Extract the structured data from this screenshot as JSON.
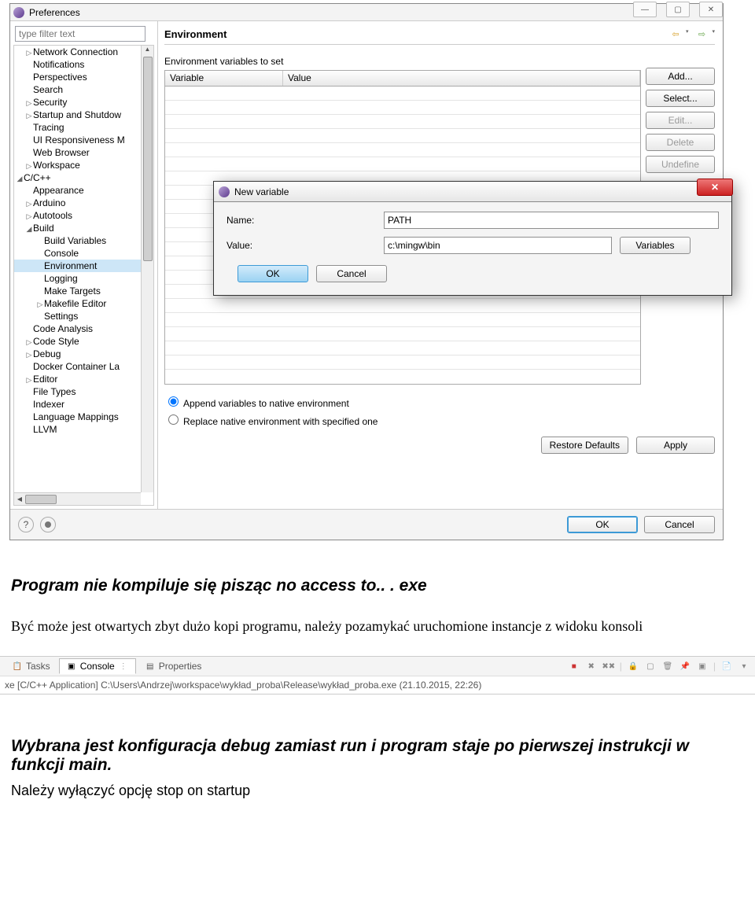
{
  "window": {
    "title": "Preferences",
    "filter_placeholder": "type filter text"
  },
  "tree": {
    "items": [
      {
        "label": "Network Connection",
        "indent": 1,
        "expander": "▷"
      },
      {
        "label": "Notifications",
        "indent": 1,
        "expander": ""
      },
      {
        "label": "Perspectives",
        "indent": 1,
        "expander": ""
      },
      {
        "label": "Search",
        "indent": 1,
        "expander": ""
      },
      {
        "label": "Security",
        "indent": 1,
        "expander": "▷"
      },
      {
        "label": "Startup and Shutdow",
        "indent": 1,
        "expander": "▷"
      },
      {
        "label": "Tracing",
        "indent": 1,
        "expander": ""
      },
      {
        "label": "UI Responsiveness M",
        "indent": 1,
        "expander": ""
      },
      {
        "label": "Web Browser",
        "indent": 1,
        "expander": ""
      },
      {
        "label": "Workspace",
        "indent": 1,
        "expander": "▷"
      },
      {
        "label": "C/C++",
        "indent": 0,
        "expander": "◢"
      },
      {
        "label": "Appearance",
        "indent": 1,
        "expander": ""
      },
      {
        "label": "Arduino",
        "indent": 1,
        "expander": "▷"
      },
      {
        "label": "Autotools",
        "indent": 1,
        "expander": "▷"
      },
      {
        "label": "Build",
        "indent": 1,
        "expander": "◢"
      },
      {
        "label": "Build Variables",
        "indent": 2,
        "expander": ""
      },
      {
        "label": "Console",
        "indent": 2,
        "expander": ""
      },
      {
        "label": "Environment",
        "indent": 2,
        "expander": "",
        "selected": true
      },
      {
        "label": "Logging",
        "indent": 2,
        "expander": ""
      },
      {
        "label": "Make Targets",
        "indent": 2,
        "expander": ""
      },
      {
        "label": "Makefile Editor",
        "indent": 2,
        "expander": "▷"
      },
      {
        "label": "Settings",
        "indent": 2,
        "expander": ""
      },
      {
        "label": "Code Analysis",
        "indent": 1,
        "expander": ""
      },
      {
        "label": "Code Style",
        "indent": 1,
        "expander": "▷"
      },
      {
        "label": "Debug",
        "indent": 1,
        "expander": "▷"
      },
      {
        "label": "Docker Container La",
        "indent": 1,
        "expander": ""
      },
      {
        "label": "Editor",
        "indent": 1,
        "expander": "▷"
      },
      {
        "label": "File Types",
        "indent": 1,
        "expander": ""
      },
      {
        "label": "Indexer",
        "indent": 1,
        "expander": ""
      },
      {
        "label": "Language Mappings",
        "indent": 1,
        "expander": ""
      },
      {
        "label": "LLVM",
        "indent": 1,
        "expander": ""
      }
    ]
  },
  "main": {
    "heading": "Environment",
    "env_label": "Environment variables to set",
    "col_variable": "Variable",
    "col_value": "Value",
    "btn_add": "Add...",
    "btn_select": "Select...",
    "btn_edit": "Edit...",
    "btn_delete": "Delete",
    "btn_undefine": "Undefine",
    "radio_append": "Append variables to native environment",
    "radio_replace": "Replace native environment with specified one",
    "btn_restore": "Restore Defaults",
    "btn_apply": "Apply"
  },
  "footer": {
    "ok": "OK",
    "cancel": "Cancel"
  },
  "dialog": {
    "title": "New variable",
    "label_name": "Name:",
    "label_value": "Value:",
    "value_name": "PATH",
    "value_value": "c:\\mingw\\bin",
    "btn_variables": "Variables",
    "btn_ok": "OK",
    "btn_cancel": "Cancel"
  },
  "doc1": {
    "heading": "Program nie kompiluje się pisząc no access to.. . exe",
    "para": "Być może jest otwartych zbyt dużo kopi programu, należy pozamykać uruchomione instancje z widoku konsoli"
  },
  "console": {
    "tab_tasks": "Tasks",
    "tab_console": "Console",
    "tab_properties": "Properties",
    "path": "xe [C/C++ Application] C:\\Users\\Andrzej\\workspace\\wykład_proba\\Release\\wykład_proba.exe (21.10.2015, 22:26)"
  },
  "doc2": {
    "heading": "Wybrana jest konfiguracja debug zamiast run i program staje po pierwszej instrukcji w funkcji main.",
    "para": "Należy wyłączyć opcję stop on startup"
  }
}
